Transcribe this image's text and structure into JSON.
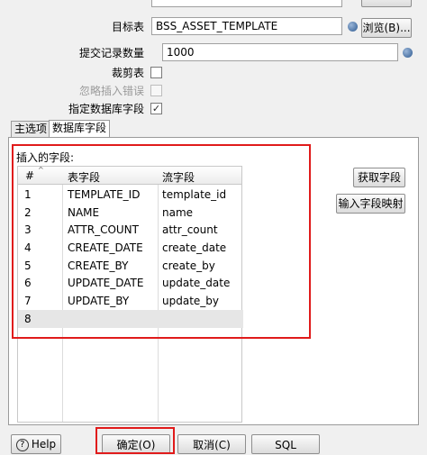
{
  "form": {
    "target_table_label": "目标表",
    "target_table_value": "BSS_ASSET_TEMPLATE",
    "commit_count_label": "提交记录数量",
    "commit_count_value": "1000",
    "truncate_label": "裁剪表",
    "ignore_errors_label": "忽略插入错误",
    "specify_fields_label": "指定数据库字段",
    "specify_fields_check": "✓",
    "browse_label": "浏览(B)...",
    "browse_label_2": "浏览(B)..."
  },
  "tabs": [
    {
      "label": "主选项"
    },
    {
      "label": "数据库字段"
    }
  ],
  "panel": {
    "fields_label": "插入的字段:",
    "col_num": "#",
    "col_table_field": "表字段",
    "col_stream_field": "流字段",
    "rows": [
      {
        "num": "1",
        "table": "TEMPLATE_ID",
        "stream": "template_id"
      },
      {
        "num": "2",
        "table": "NAME",
        "stream": "name"
      },
      {
        "num": "3",
        "table": "ATTR_COUNT",
        "stream": "attr_count"
      },
      {
        "num": "4",
        "table": "CREATE_DATE",
        "stream": "create_date"
      },
      {
        "num": "5",
        "table": "CREATE_BY",
        "stream": "create_by"
      },
      {
        "num": "6",
        "table": "UPDATE_DATE",
        "stream": "update_date"
      },
      {
        "num": "7",
        "table": "UPDATE_BY",
        "stream": "update_by"
      },
      {
        "num": "8",
        "table": "",
        "stream": ""
      }
    ],
    "get_fields_label": "获取字段",
    "map_fields_label": "输入字段映射"
  },
  "footer": {
    "help_label": "Help",
    "help_icon": "?",
    "ok_label": "确定(O)",
    "cancel_label": "取消(C)",
    "sql_label": "SQL"
  },
  "colors": {
    "highlight": "#e01b1b"
  }
}
